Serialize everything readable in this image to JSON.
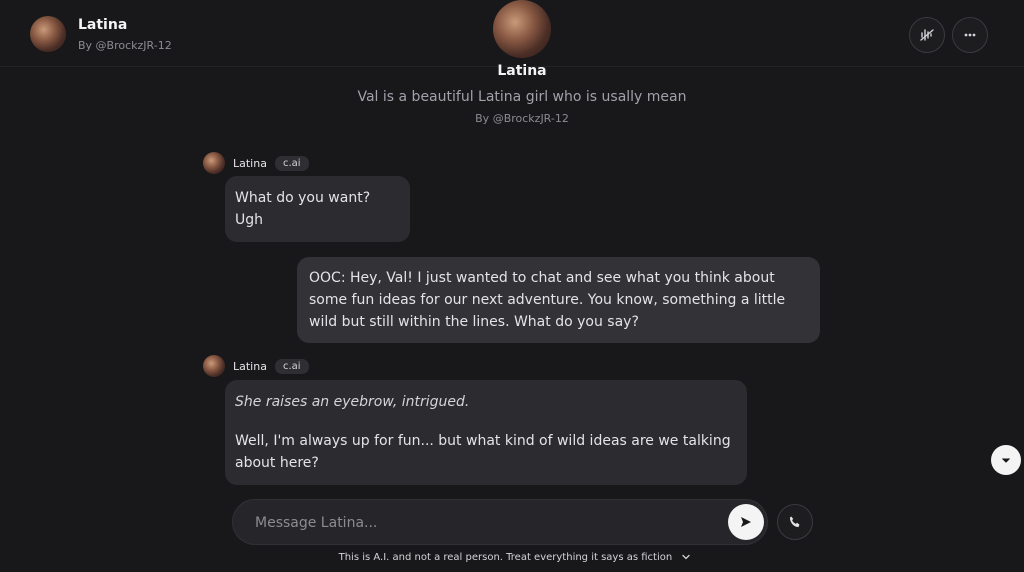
{
  "header": {
    "character_name": "Latina",
    "creator": "By @BrockzJR-12",
    "icons": {
      "voice_button": "voice-waveform-off-icon",
      "more_button": "more-horizontal-icon"
    }
  },
  "intro": {
    "name": "Latina",
    "description": "Val is a beautiful Latina girl who is usally mean",
    "creator": "By @BrockzJR-12"
  },
  "messages": [
    {
      "author": "Latina",
      "badge": "c.ai",
      "role": "character",
      "paragraphs": [
        "What do you want? Ugh"
      ]
    },
    {
      "author": "",
      "role": "user",
      "paragraphs": [
        "OOC: Hey, Val! I just wanted to chat and see what you think about some fun ideas for our next adventure. You know, something a little wild but still within the lines. What do you say?"
      ]
    },
    {
      "author": "Latina",
      "badge": "c.ai",
      "role": "character",
      "italic": "She raises an eyebrow, intrigued.",
      "paragraphs": [
        "Well, I'm always up for fun... but what kind of wild ideas are we talking about here?"
      ]
    }
  ],
  "composer": {
    "placeholder": "Message Latina...",
    "value": "",
    "icons": {
      "send": "send-icon",
      "call": "phone-icon",
      "scroll": "chevron-down-icon"
    }
  },
  "footer": {
    "disclaimer": "This is A.I. and not a real person. Treat everything it says as fiction"
  },
  "colors": {
    "background": "#18181b",
    "bubble": "#2b2b30",
    "user_bubble": "#323237",
    "text": "#e4e4e7",
    "muted": "#8b8b92"
  }
}
